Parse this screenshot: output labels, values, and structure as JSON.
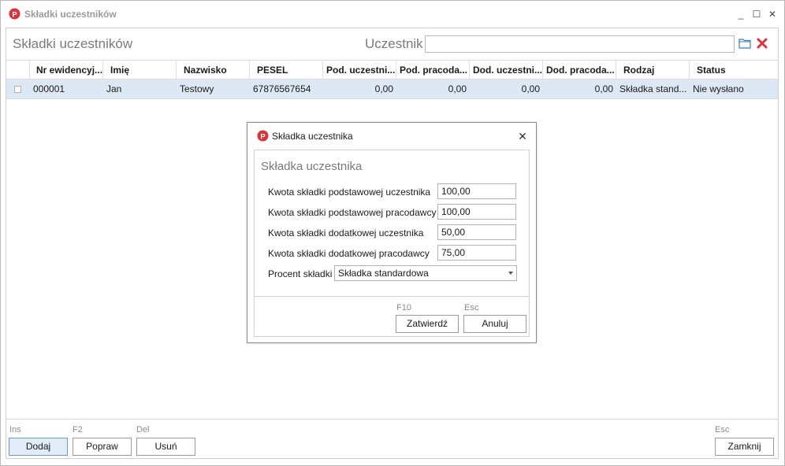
{
  "window": {
    "title": "Składki uczestników",
    "controls": {
      "minimize": "_",
      "maximize": "☐",
      "close": "✕"
    }
  },
  "header": {
    "page_title": "Składki uczestników",
    "filter_label": "Uczestnik",
    "filter_value": ""
  },
  "grid": {
    "columns": [
      "Nr ewidencyj...",
      "Imię",
      "Nazwisko",
      "PESEL",
      "Pod. uczestni...",
      "Pod. pracoda...",
      "Dod. uczestni...",
      "Dod. pracoda...",
      "Rodzaj",
      "Status"
    ],
    "rows": [
      [
        "000001",
        "Jan",
        "Testowy",
        "67876567654",
        "0,00",
        "0,00",
        "0,00",
        "0,00",
        "Składka stand...",
        "Nie wysłano"
      ]
    ]
  },
  "dialog": {
    "title": "Składka uczestnika",
    "heading": "Składka uczestnika",
    "fields": [
      {
        "label": "Kwota składki podstawowej uczestnika",
        "value": "100,00"
      },
      {
        "label": "Kwota składki podstawowej pracodawcy",
        "value": "100,00"
      },
      {
        "label": "Kwota składki dodatkowej uczestnika",
        "value": "50,00"
      },
      {
        "label": "Kwota składki dodatkowej pracodawcy",
        "value": "75,00"
      }
    ],
    "percent_label": "Procent składki",
    "percent_value": "Składka standardowa",
    "confirm_hotkey": "F10",
    "confirm_label": "Zatwierdź",
    "cancel_hotkey": "Esc",
    "cancel_label": "Anuluj"
  },
  "footer": {
    "add_hotkey": "Ins",
    "add_label": "Dodaj",
    "edit_hotkey": "F2",
    "edit_label": "Popraw",
    "delete_hotkey": "Del",
    "delete_label": "Usuń",
    "close_hotkey": "Esc",
    "close_label": "Zamknij"
  },
  "colors": {
    "accent": "#d9343c",
    "selected_row": "#dce8f3",
    "primary_button": "#e1ecf7"
  }
}
